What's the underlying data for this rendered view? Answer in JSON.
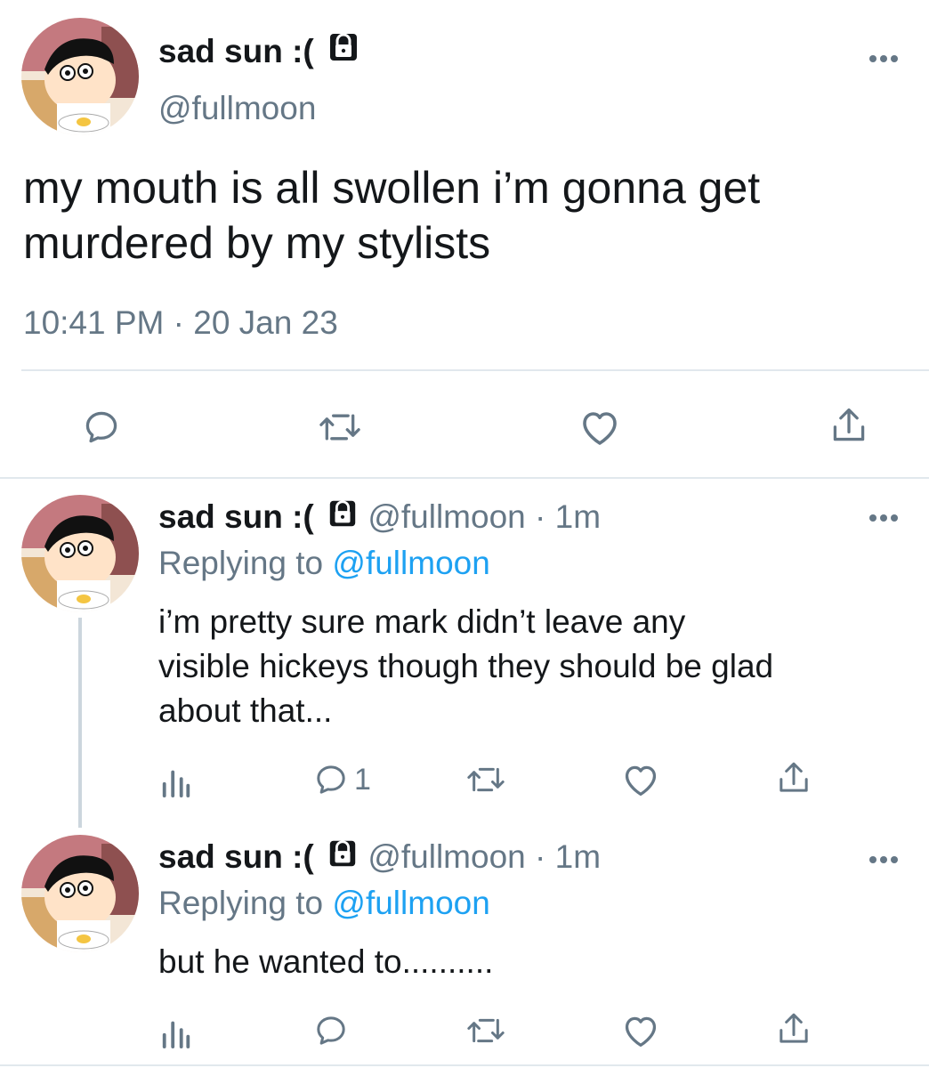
{
  "main_tweet": {
    "display_name": "sad sun :(",
    "handle": "@fullmoon",
    "text_line1": "my mouth is all swollen i’m gonna get",
    "text_line2": "murdered by my stylists",
    "timestamp": "10:41 PM · 20 Jan 23"
  },
  "replies": [
    {
      "display_name": "sad sun :(",
      "handle": "@fullmoon",
      "time": "· 1m",
      "replying_prefix": "Replying to",
      "replying_handle": "@fullmoon",
      "line1": "i’m pretty sure mark didn’t leave any",
      "line2": "visible hickeys though they should be glad",
      "line3": "about that...",
      "reply_count": "1"
    },
    {
      "display_name": "sad sun :(",
      "handle": "@fullmoon",
      "time": "· 1m",
      "replying_prefix": "Replying to",
      "replying_handle": "@fullmoon",
      "line1": "but he wanted to..........",
      "reply_count": ""
    }
  ],
  "colors": {
    "text": "#14171a",
    "muted": "#657786",
    "link": "#1da1f2",
    "divider": "#e1e8ed"
  },
  "icons": [
    "lock-icon",
    "more-icon",
    "reply-icon",
    "retweet-icon",
    "like-icon",
    "share-icon",
    "analytics-icon"
  ]
}
